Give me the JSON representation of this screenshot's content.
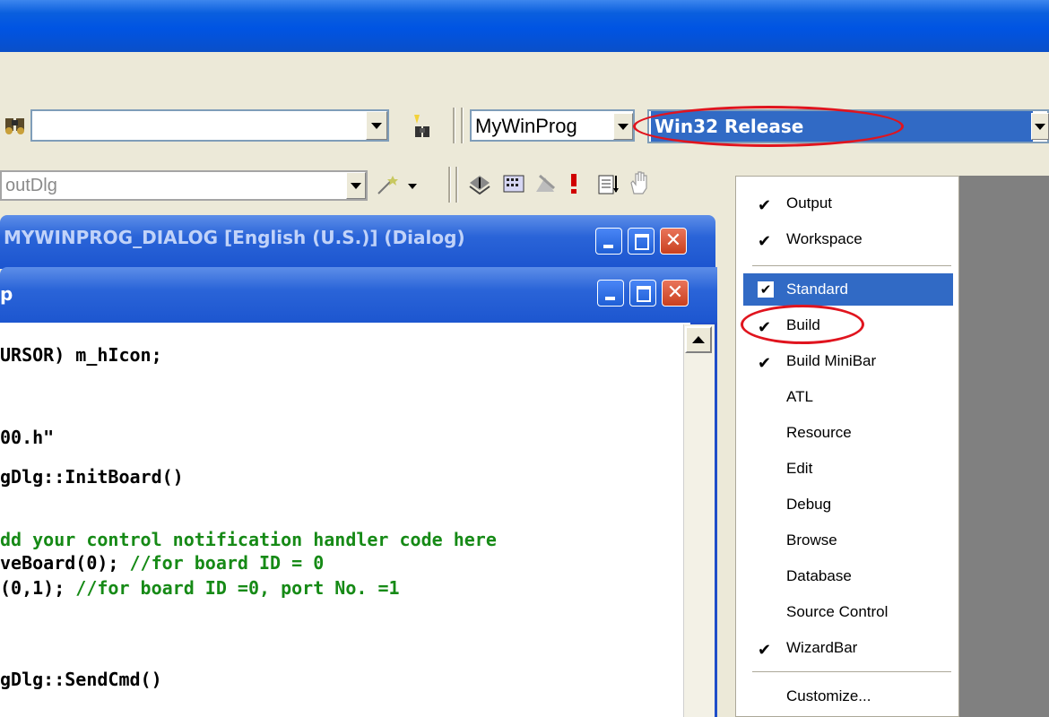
{
  "toolbar": {
    "find_combo_value": "",
    "project_combo": "MyWinProg",
    "config_combo": "Win32 Release",
    "class_combo": "outDlg"
  },
  "windows": {
    "dialog_title": "MYWINPROG_DIALOG [English (U.S.)] (Dialog)",
    "editor_title": "p"
  },
  "code_lines": [
    {
      "text": "URSOR) m_hIcon;",
      "color": "black"
    },
    {
      "text": "",
      "color": "black"
    },
    {
      "text": "",
      "color": "black"
    },
    {
      "text": "00.h\"",
      "color": "black"
    },
    {
      "text": "gDlg::InitBoard()",
      "color": "black"
    },
    {
      "text": "",
      "color": "black"
    },
    {
      "text": "dd your control notification handler code here",
      "color": "green"
    },
    {
      "text": "veBoard(0); //for board ID = 0",
      "color": "mixed",
      "black": "veBoard(0); ",
      "green": "//for board ID = 0"
    },
    {
      "text": "(0,1); //for board ID =0, port No. =1",
      "color": "mixed",
      "black": "(0,1); ",
      "green": "//for board ID =0, port No. =1"
    },
    {
      "text": "",
      "color": "black"
    },
    {
      "text": "",
      "color": "black"
    },
    {
      "text": "gDlg::SendCmd()",
      "color": "black"
    }
  ],
  "menu": {
    "items": [
      {
        "label": "Output",
        "checked": "✔"
      },
      {
        "label": "Workspace",
        "checked": "✔"
      },
      {
        "label": "Standard",
        "checked": "✔",
        "highlighted": true
      },
      {
        "label": "Build",
        "checked": "✔"
      },
      {
        "label": "Build MiniBar",
        "checked": "✔"
      },
      {
        "label": "ATL",
        "checked": ""
      },
      {
        "label": "Resource",
        "checked": ""
      },
      {
        "label": "Edit",
        "checked": ""
      },
      {
        "label": "Debug",
        "checked": ""
      },
      {
        "label": "Browse",
        "checked": ""
      },
      {
        "label": "Database",
        "checked": ""
      },
      {
        "label": "Source Control",
        "checked": ""
      },
      {
        "label": "WizardBar",
        "checked": "✔"
      },
      {
        "label": "Customize...",
        "checked": ""
      }
    ]
  },
  "colors": {
    "highlight": "#316ac5",
    "annotation_red": "#e0141e",
    "comment_green": "#168a16"
  }
}
